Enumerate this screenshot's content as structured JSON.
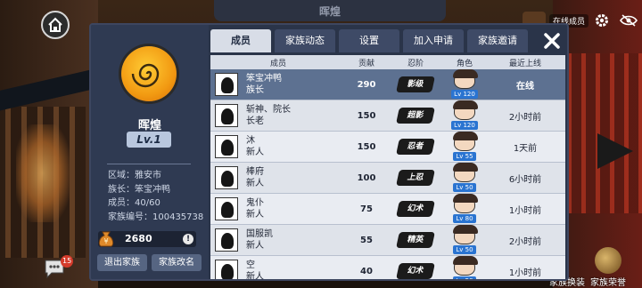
{
  "hud": {
    "online_label": "在线成员",
    "chat_badge": "15",
    "bottom_items": [
      {
        "label": "家族换装"
      },
      {
        "label": "家族荣誉"
      }
    ]
  },
  "background": {
    "top_title": "晖煌"
  },
  "family": {
    "name": "晖煌",
    "level": "Lv.1",
    "region": "区域：雅安市",
    "leader": "族长：笨宝冲鸭",
    "members": "成员：40/60",
    "id": "家族编号：100435738",
    "funds": "2680",
    "exit_label": "退出家族",
    "rename_label": "家族改名"
  },
  "tabs": [
    {
      "label": "成员",
      "active": true
    },
    {
      "label": "家族动态",
      "active": false
    },
    {
      "label": "设置",
      "active": false
    },
    {
      "label": "加入申请",
      "active": false
    },
    {
      "label": "家族邀请",
      "active": false
    }
  ],
  "table": {
    "headers": {
      "member": "成员",
      "contrib": "贡献",
      "rank": "忍阶",
      "char": "角色",
      "last": "最近上线"
    },
    "rows": [
      {
        "name": "笨宝冲鸭",
        "role": "族长",
        "contrib": "290",
        "rank": "影级",
        "lv": "Lv 120",
        "last": "在线",
        "me": true
      },
      {
        "name": "斩神、院长",
        "role": "长老",
        "contrib": "150",
        "rank": "超影",
        "lv": "Lv 120",
        "last": "2小时前",
        "me": false
      },
      {
        "name": "沐",
        "role": "新人",
        "contrib": "150",
        "rank": "忍者",
        "lv": "Lv 55",
        "last": "1天前",
        "me": false
      },
      {
        "name": "棒府",
        "role": "新人",
        "contrib": "100",
        "rank": "上忍",
        "lv": "Lv 50",
        "last": "6小时前",
        "me": false
      },
      {
        "name": "鬼仆",
        "role": "新人",
        "contrib": "75",
        "rank": "幻术",
        "lv": "Lv 80",
        "last": "1小时前",
        "me": false
      },
      {
        "name": "国服凯",
        "role": "新人",
        "contrib": "55",
        "rank": "精英",
        "lv": "Lv 50",
        "last": "2小时前",
        "me": false
      },
      {
        "name": "空",
        "role": "新人",
        "contrib": "40",
        "rank": "幻术",
        "lv": "Lv 50",
        "last": "1小时前",
        "me": false
      }
    ]
  },
  "colors": {
    "panel": "#2a3449",
    "active_tab": "#d8dde7",
    "highlight_row": "#5d7191",
    "lv_tag": "#2a74d1",
    "emblem": "#f29a12"
  }
}
